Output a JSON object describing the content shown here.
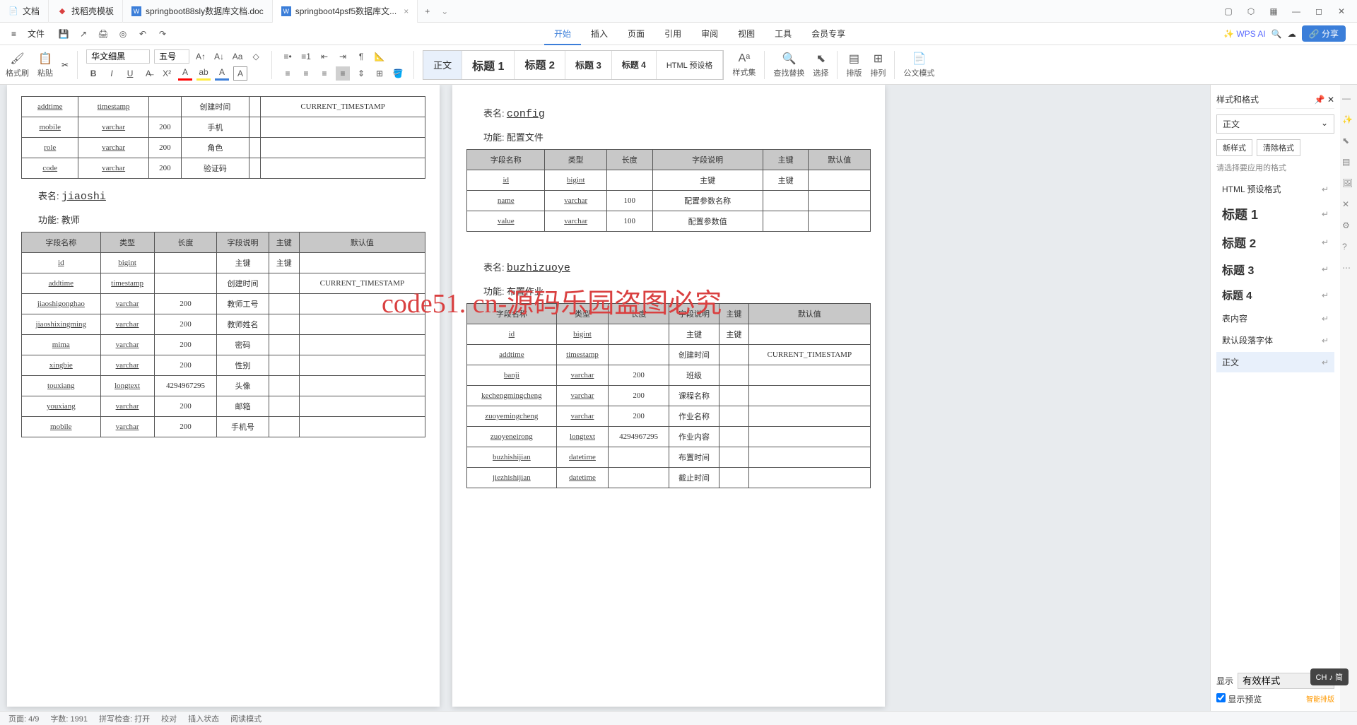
{
  "tabs": [
    {
      "icon": "📄",
      "label": "文档",
      "color": "#3b7ed9"
    },
    {
      "icon": "📕",
      "label": "找稻壳模板",
      "color": "#d94040"
    },
    {
      "icon": "W",
      "label": "springboot88sly数据库文档.doc",
      "color": "#3b7ed9"
    },
    {
      "icon": "W",
      "label": "springboot4psf5数据库文...",
      "color": "#3b7ed9",
      "active": true
    }
  ],
  "menu": {
    "file": "文件",
    "tabs": [
      "开始",
      "插入",
      "页面",
      "引用",
      "审阅",
      "视图",
      "工具",
      "会员专享"
    ],
    "wpsai": "WPS AI",
    "share": "分享"
  },
  "toolbar": {
    "fmtbrush": "格式刷",
    "paste": "粘贴",
    "font": "华文细黑",
    "size": "五号",
    "styles": [
      "正文",
      "标题 1",
      "标题 2",
      "标题 3",
      "标题 4",
      "HTML 预设格"
    ],
    "styleset": "样式集",
    "findrep": "查找替换",
    "select": "选择",
    "sort": "排版",
    "arrange": "排列",
    "official": "公文模式"
  },
  "doc": {
    "table1_rows": [
      [
        "addtime",
        "timestamp",
        "",
        "创建时间",
        "",
        "CURRENT_TIMESTAMP"
      ],
      [
        "mobile",
        "varchar",
        "200",
        "手机",
        "",
        ""
      ],
      [
        "role",
        "varchar",
        "200",
        "角色",
        "",
        ""
      ],
      [
        "code",
        "varchar",
        "200",
        "验证码",
        "",
        ""
      ]
    ],
    "t2": {
      "name": "jiaoshi",
      "func": "教师",
      "label_table": "表名:",
      "label_func": "功能:"
    },
    "table2_head": [
      "字段名称",
      "类型",
      "长度",
      "字段说明",
      "主键",
      "默认值"
    ],
    "table2_rows": [
      [
        "id",
        "bigint",
        "",
        "主键",
        "主键",
        ""
      ],
      [
        "addtime",
        "timestamp",
        "",
        "创建时间",
        "",
        "CURRENT_TIMESTAMP"
      ],
      [
        "jiaoshigonghao",
        "varchar",
        "200",
        "教师工号",
        "",
        ""
      ],
      [
        "jiaoshixingming",
        "varchar",
        "200",
        "教师姓名",
        "",
        ""
      ],
      [
        "mima",
        "varchar",
        "200",
        "密码",
        "",
        ""
      ],
      [
        "xingbie",
        "varchar",
        "200",
        "性别",
        "",
        ""
      ],
      [
        "touxiang",
        "longtext",
        "4294967295",
        "头像",
        "",
        ""
      ],
      [
        "youxiang",
        "varchar",
        "200",
        "邮箱",
        "",
        ""
      ],
      [
        "mobile",
        "varchar",
        "200",
        "手机号",
        "",
        ""
      ]
    ],
    "t3": {
      "name": "config",
      "func": "配置文件"
    },
    "table3_rows": [
      [
        "id",
        "bigint",
        "",
        "主键",
        "主键",
        ""
      ],
      [
        "name",
        "varchar",
        "100",
        "配置参数名称",
        "",
        ""
      ],
      [
        "value",
        "varchar",
        "100",
        "配置参数值",
        "",
        ""
      ]
    ],
    "t4": {
      "name": "buzhizuoye",
      "func": "布置作业"
    },
    "table4_rows": [
      [
        "id",
        "bigint",
        "",
        "主键",
        "主键",
        ""
      ],
      [
        "addtime",
        "timestamp",
        "",
        "创建时间",
        "",
        "CURRENT_TIMESTAMP"
      ],
      [
        "banji",
        "varchar",
        "200",
        "班级",
        "",
        ""
      ],
      [
        "kechengmingcheng",
        "varchar",
        "200",
        "课程名称",
        "",
        ""
      ],
      [
        "zuoyemingcheng",
        "varchar",
        "200",
        "作业名称",
        "",
        ""
      ],
      [
        "zuoyeneirong",
        "longtext",
        "4294967295",
        "作业内容",
        "",
        ""
      ],
      [
        "buzhishijian",
        "datetime",
        "",
        "布置时间",
        "",
        ""
      ],
      [
        "jiezhishijian",
        "datetime",
        "",
        "截止时间",
        "",
        ""
      ]
    ]
  },
  "sidepanel": {
    "title": "样式和格式",
    "current": "正文",
    "newstyle": "新样式",
    "clear": "清除格式",
    "hint": "请选择要应用的格式",
    "items": [
      "HTML 预设格式",
      "标题 1",
      "标题 2",
      "标题 3",
      "标题 4",
      "表内容",
      "默认段落字体",
      "正文"
    ],
    "show": "显示",
    "showval": "有效样式",
    "preview": "显示预览",
    "smart": "智能排版"
  },
  "watermark": "code51. cn-源码乐园盗图必究",
  "ime": "CH ♪ 简",
  "status": {
    "page": "页面: 4/9",
    "words": "字数: 1991",
    "spell": "拼写检查: 打开",
    "proof": "校对",
    "insert": "插入状态",
    "read": "阅读模式"
  }
}
